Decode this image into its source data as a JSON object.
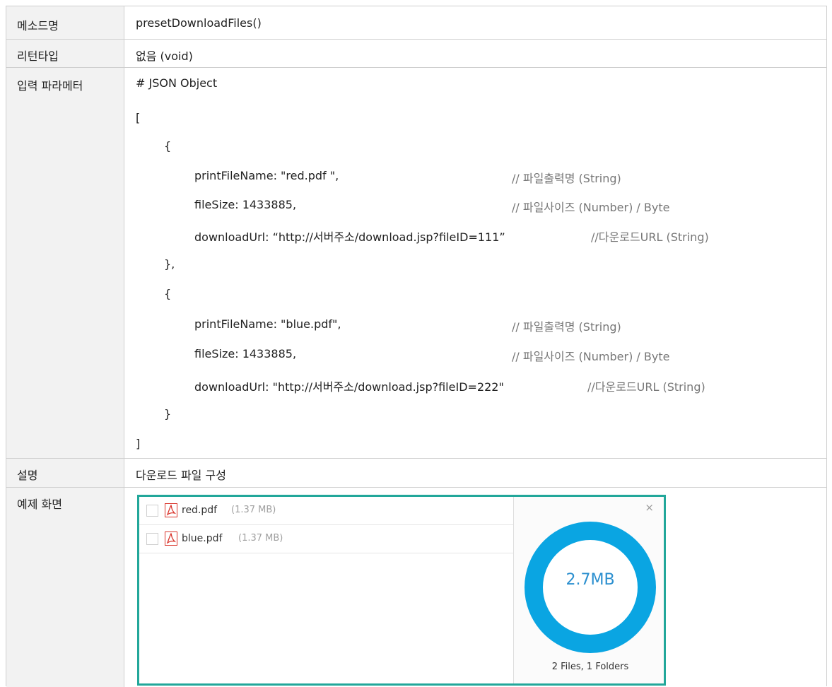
{
  "rows": {
    "method": {
      "label": "메소드명",
      "value": "presetDownloadFiles()"
    },
    "return_type": {
      "label": "리턴타입",
      "value": "없음 (void)"
    },
    "params": {
      "label": "입력 파라메터",
      "lines": [
        "# JSON Object",
        "[",
        "{",
        "printFileName: \"red.pdf \",",
        "fileSize: 1433885,",
        "downloadUrl: “http://서버주소/download.jsp?fileID=111”",
        "},",
        "{",
        "printFileName: \"blue.pdf\",",
        "fileSize: 1433885,",
        "downloadUrl: \"http://서버주소/download.jsp?fileID=222\"",
        "}",
        "]"
      ],
      "comments": {
        "c1": "// 파일출력명 (String)",
        "c2": "// 파일사이즈 (Number) / Byte",
        "c3": "//다운로드URL (String)",
        "c4": "// 파일출력명 (String)",
        "c5": "// 파일사이즈 (Number) / Byte",
        "c6": "//다운로드URL (String)"
      }
    },
    "description": {
      "label": "설명",
      "value": "다운로드 파일 구성"
    },
    "example": {
      "label": "예제 화면"
    }
  },
  "widget": {
    "files": [
      {
        "name": "red.pdf",
        "size": "(1.37 MB)",
        "icon": "pdf-icon"
      },
      {
        "name": "blue.pdf",
        "size": "(1.37 MB)",
        "icon": "pdf-icon"
      }
    ],
    "total_size": "2.7MB",
    "summary": "2 Files, 1 Folders",
    "close_glyph": "×",
    "colors": {
      "border": "#22a79a",
      "ring": "#0aa5e2",
      "total_text": "#2b8fcf",
      "pdf_icon": "#d9342b"
    }
  }
}
